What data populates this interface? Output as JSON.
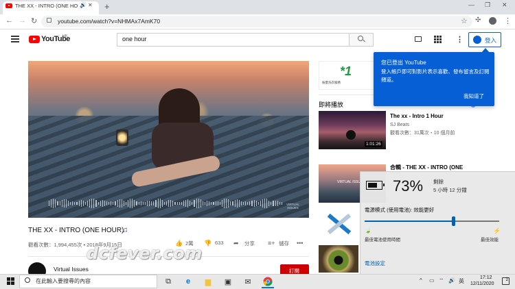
{
  "browser": {
    "tab_title": "THE XX - INTRO (ONE HOU",
    "url": "youtube.com/watch?v=NHMAx7AmK70"
  },
  "youtube": {
    "wordmark": "YouTube",
    "region": "HK",
    "search_query": "one hour",
    "signin_label": "登入"
  },
  "video": {
    "title": "THE XX - INTRO (ONE HOUR)",
    "views": "觀看次數：1,994,455次 • 2018年9月15日",
    "likes": "2萬",
    "dislikes": "633",
    "share_label": "分享",
    "save_label": "儲存",
    "channel": "Virtual Issues",
    "subscribe_label": "訂閱",
    "player_brand": "VIRTUAL\nISSUES"
  },
  "sidebar": {
    "up_next_label": "即將播放",
    "ad_text": "按量洗衣服務",
    "items": [
      {
        "title": "The xx - Intro 1 Hour",
        "channel": "SJ Beats",
        "meta": "觀看次數：31萬次・10 個月前",
        "duration": "1:01:26"
      },
      {
        "title": "合輯 - THE XX - INTRO (ONE",
        "thumb_text": "VIRTUAL ISSUES"
      }
    ]
  },
  "tooltip": {
    "title": "您已登出 YouTube",
    "body": "登入帳戶即可對影片表示喜歡、發布留言及訂閱頻道。",
    "ok_label": "我知道了"
  },
  "battery": {
    "percent_text": "73%",
    "level": 73,
    "status": "剩餘",
    "time_left": "5 小時 12 分鐘",
    "power_mode_label": "電源模式 (使用電池): 效能更好",
    "slider_left_label": "最佳電池使用時間",
    "slider_right_label": "最佳效能",
    "settings_link": "電池設定"
  },
  "watermark": "dcfever.com",
  "taskbar": {
    "search_placeholder": "在此輸入要搜尋的內容",
    "ime_label": "英",
    "clock_time": "17:12",
    "clock_date": "12/11/2020",
    "notification_count": "2"
  },
  "colors": {
    "youtube_red": "#ff0000",
    "youtube_blue": "#065fd4",
    "windows_accent": "#0063b1"
  }
}
